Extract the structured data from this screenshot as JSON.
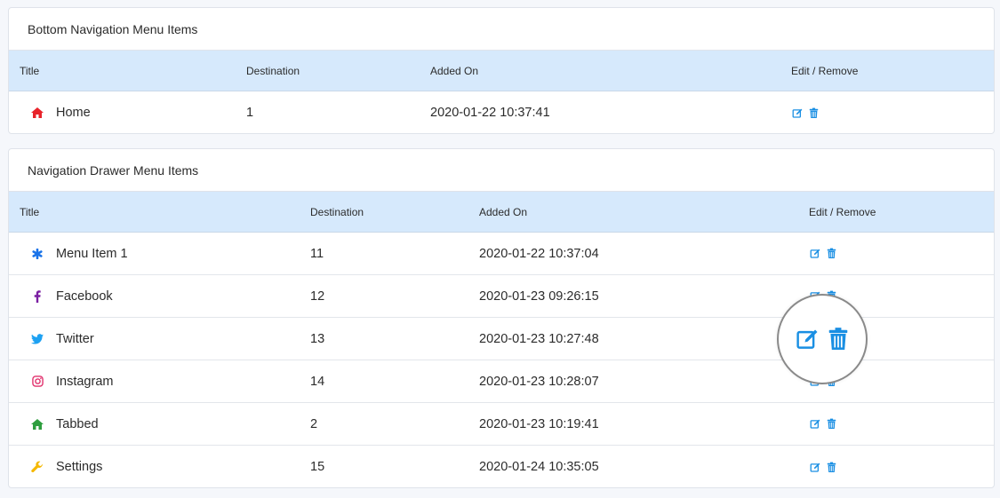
{
  "bottom_nav": {
    "heading": "Bottom Navigation Menu Items",
    "columns": {
      "title": "Title",
      "destination": "Destination",
      "added_on": "Added On",
      "edit_remove": "Edit / Remove"
    },
    "rows": [
      {
        "title": "Home",
        "destination": "1",
        "added_on": "2020-01-22 10:37:41",
        "icon": "home-icon",
        "icon_color": "#e8232a"
      }
    ]
  },
  "drawer_nav": {
    "heading": "Navigation Drawer Menu Items",
    "columns": {
      "title": "Title",
      "destination": "Destination",
      "added_on": "Added On",
      "edit_remove": "Edit / Remove"
    },
    "rows": [
      {
        "title": "Menu Item 1",
        "destination": "11",
        "added_on": "2020-01-22 10:37:04",
        "icon": "asterisk-icon",
        "icon_color": "#1a73e8"
      },
      {
        "title": "Facebook",
        "destination": "12",
        "added_on": "2020-01-23 09:26:15",
        "icon": "facebook-icon",
        "icon_color": "#7b1fa2"
      },
      {
        "title": "Twitter",
        "destination": "13",
        "added_on": "2020-01-23 10:27:48",
        "icon": "twitter-icon",
        "icon_color": "#1da1f2"
      },
      {
        "title": "Instagram",
        "destination": "14",
        "added_on": "2020-01-23 10:28:07",
        "icon": "instagram-icon",
        "icon_color": "#e1306c"
      },
      {
        "title": "Tabbed",
        "destination": "2",
        "added_on": "2020-01-23 10:19:41",
        "icon": "home-icon",
        "icon_color": "#2e9e3e"
      },
      {
        "title": "Settings",
        "destination": "15",
        "added_on": "2020-01-24 10:35:05",
        "icon": "wrench-icon",
        "icon_color": "#f5b800"
      }
    ]
  },
  "colors": {
    "accent": "#1a8fe3",
    "table_header_bg": "#d6e9fc"
  }
}
